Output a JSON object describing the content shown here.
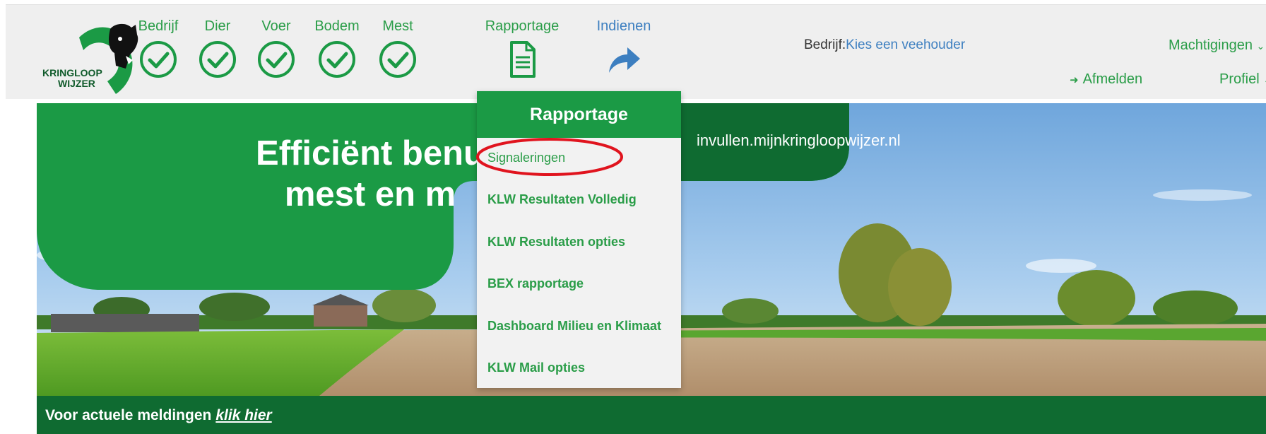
{
  "logo": {
    "line1": "KRINGLOOP",
    "line2": "WIJZER"
  },
  "steps": [
    {
      "label": "Bedrijf",
      "icon": "check-circle-icon"
    },
    {
      "label": "Dier",
      "icon": "check-circle-icon"
    },
    {
      "label": "Voer",
      "icon": "check-circle-icon"
    },
    {
      "label": "Bodem",
      "icon": "check-circle-icon"
    },
    {
      "label": "Mest",
      "icon": "check-circle-icon"
    },
    {
      "label": "Rapportage",
      "icon": "document-icon"
    },
    {
      "label": "Indienen",
      "icon": "share-arrow-icon"
    }
  ],
  "company": {
    "label": "Bedrijf:",
    "value": "Kies een veehouder"
  },
  "nav": {
    "machtigingen": "Machtigingen",
    "afmelden": "Afmelden",
    "profiel": "Profiel"
  },
  "hero": {
    "slogan_line1": "Efficiënt benu",
    "slogan_line2": "mest en m",
    "url": "invullen.mijnkringloopwijzer.nl"
  },
  "dropdown": {
    "title": "Rapportage",
    "items": [
      "Signaleringen",
      "KLW Resultaten Volledig",
      "KLW Resultaten opties",
      "BEX rapportage",
      "Dashboard Milieu en Klimaat",
      "KLW Mail opties"
    ]
  },
  "notice": {
    "text": "Voor actuele meldingen",
    "link": "klik hier"
  },
  "colors": {
    "brand_green": "#2a9d48",
    "dark_green": "#0f6b31",
    "link_blue": "#3d7fc0",
    "highlight_red": "#e0141e"
  }
}
